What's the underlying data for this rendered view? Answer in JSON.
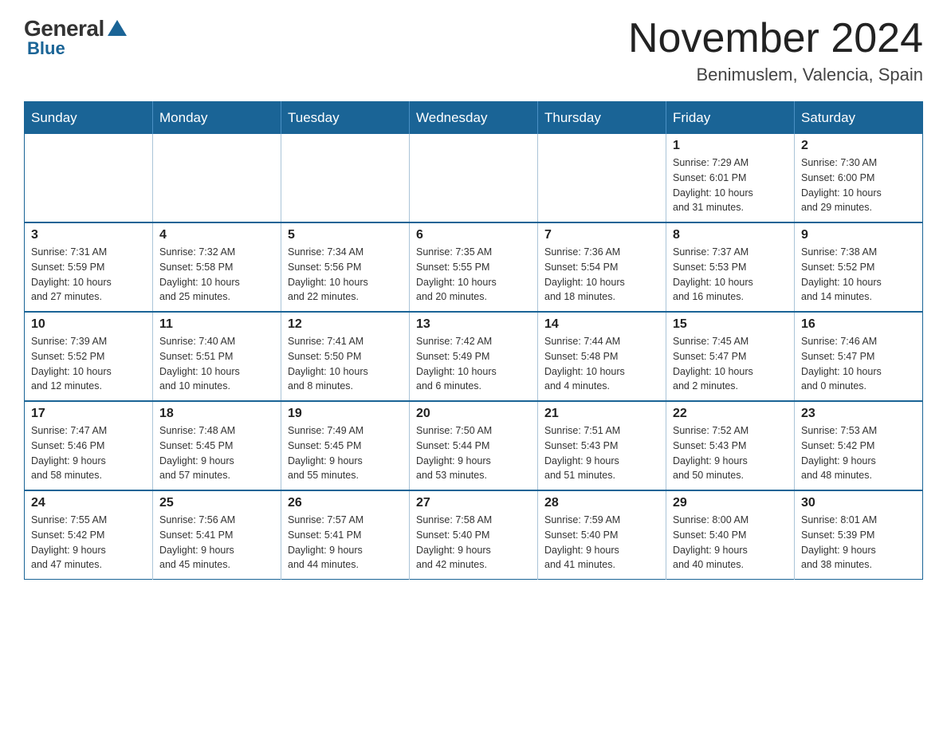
{
  "header": {
    "logo_general": "General",
    "logo_blue": "Blue",
    "month_title": "November 2024",
    "location": "Benimuslem, Valencia, Spain"
  },
  "days_of_week": [
    "Sunday",
    "Monday",
    "Tuesday",
    "Wednesday",
    "Thursday",
    "Friday",
    "Saturday"
  ],
  "weeks": [
    [
      {
        "day": "",
        "info": ""
      },
      {
        "day": "",
        "info": ""
      },
      {
        "day": "",
        "info": ""
      },
      {
        "day": "",
        "info": ""
      },
      {
        "day": "",
        "info": ""
      },
      {
        "day": "1",
        "info": "Sunrise: 7:29 AM\nSunset: 6:01 PM\nDaylight: 10 hours\nand 31 minutes."
      },
      {
        "day": "2",
        "info": "Sunrise: 7:30 AM\nSunset: 6:00 PM\nDaylight: 10 hours\nand 29 minutes."
      }
    ],
    [
      {
        "day": "3",
        "info": "Sunrise: 7:31 AM\nSunset: 5:59 PM\nDaylight: 10 hours\nand 27 minutes."
      },
      {
        "day": "4",
        "info": "Sunrise: 7:32 AM\nSunset: 5:58 PM\nDaylight: 10 hours\nand 25 minutes."
      },
      {
        "day": "5",
        "info": "Sunrise: 7:34 AM\nSunset: 5:56 PM\nDaylight: 10 hours\nand 22 minutes."
      },
      {
        "day": "6",
        "info": "Sunrise: 7:35 AM\nSunset: 5:55 PM\nDaylight: 10 hours\nand 20 minutes."
      },
      {
        "day": "7",
        "info": "Sunrise: 7:36 AM\nSunset: 5:54 PM\nDaylight: 10 hours\nand 18 minutes."
      },
      {
        "day": "8",
        "info": "Sunrise: 7:37 AM\nSunset: 5:53 PM\nDaylight: 10 hours\nand 16 minutes."
      },
      {
        "day": "9",
        "info": "Sunrise: 7:38 AM\nSunset: 5:52 PM\nDaylight: 10 hours\nand 14 minutes."
      }
    ],
    [
      {
        "day": "10",
        "info": "Sunrise: 7:39 AM\nSunset: 5:52 PM\nDaylight: 10 hours\nand 12 minutes."
      },
      {
        "day": "11",
        "info": "Sunrise: 7:40 AM\nSunset: 5:51 PM\nDaylight: 10 hours\nand 10 minutes."
      },
      {
        "day": "12",
        "info": "Sunrise: 7:41 AM\nSunset: 5:50 PM\nDaylight: 10 hours\nand 8 minutes."
      },
      {
        "day": "13",
        "info": "Sunrise: 7:42 AM\nSunset: 5:49 PM\nDaylight: 10 hours\nand 6 minutes."
      },
      {
        "day": "14",
        "info": "Sunrise: 7:44 AM\nSunset: 5:48 PM\nDaylight: 10 hours\nand 4 minutes."
      },
      {
        "day": "15",
        "info": "Sunrise: 7:45 AM\nSunset: 5:47 PM\nDaylight: 10 hours\nand 2 minutes."
      },
      {
        "day": "16",
        "info": "Sunrise: 7:46 AM\nSunset: 5:47 PM\nDaylight: 10 hours\nand 0 minutes."
      }
    ],
    [
      {
        "day": "17",
        "info": "Sunrise: 7:47 AM\nSunset: 5:46 PM\nDaylight: 9 hours\nand 58 minutes."
      },
      {
        "day": "18",
        "info": "Sunrise: 7:48 AM\nSunset: 5:45 PM\nDaylight: 9 hours\nand 57 minutes."
      },
      {
        "day": "19",
        "info": "Sunrise: 7:49 AM\nSunset: 5:45 PM\nDaylight: 9 hours\nand 55 minutes."
      },
      {
        "day": "20",
        "info": "Sunrise: 7:50 AM\nSunset: 5:44 PM\nDaylight: 9 hours\nand 53 minutes."
      },
      {
        "day": "21",
        "info": "Sunrise: 7:51 AM\nSunset: 5:43 PM\nDaylight: 9 hours\nand 51 minutes."
      },
      {
        "day": "22",
        "info": "Sunrise: 7:52 AM\nSunset: 5:43 PM\nDaylight: 9 hours\nand 50 minutes."
      },
      {
        "day": "23",
        "info": "Sunrise: 7:53 AM\nSunset: 5:42 PM\nDaylight: 9 hours\nand 48 minutes."
      }
    ],
    [
      {
        "day": "24",
        "info": "Sunrise: 7:55 AM\nSunset: 5:42 PM\nDaylight: 9 hours\nand 47 minutes."
      },
      {
        "day": "25",
        "info": "Sunrise: 7:56 AM\nSunset: 5:41 PM\nDaylight: 9 hours\nand 45 minutes."
      },
      {
        "day": "26",
        "info": "Sunrise: 7:57 AM\nSunset: 5:41 PM\nDaylight: 9 hours\nand 44 minutes."
      },
      {
        "day": "27",
        "info": "Sunrise: 7:58 AM\nSunset: 5:40 PM\nDaylight: 9 hours\nand 42 minutes."
      },
      {
        "day": "28",
        "info": "Sunrise: 7:59 AM\nSunset: 5:40 PM\nDaylight: 9 hours\nand 41 minutes."
      },
      {
        "day": "29",
        "info": "Sunrise: 8:00 AM\nSunset: 5:40 PM\nDaylight: 9 hours\nand 40 minutes."
      },
      {
        "day": "30",
        "info": "Sunrise: 8:01 AM\nSunset: 5:39 PM\nDaylight: 9 hours\nand 38 minutes."
      }
    ]
  ]
}
